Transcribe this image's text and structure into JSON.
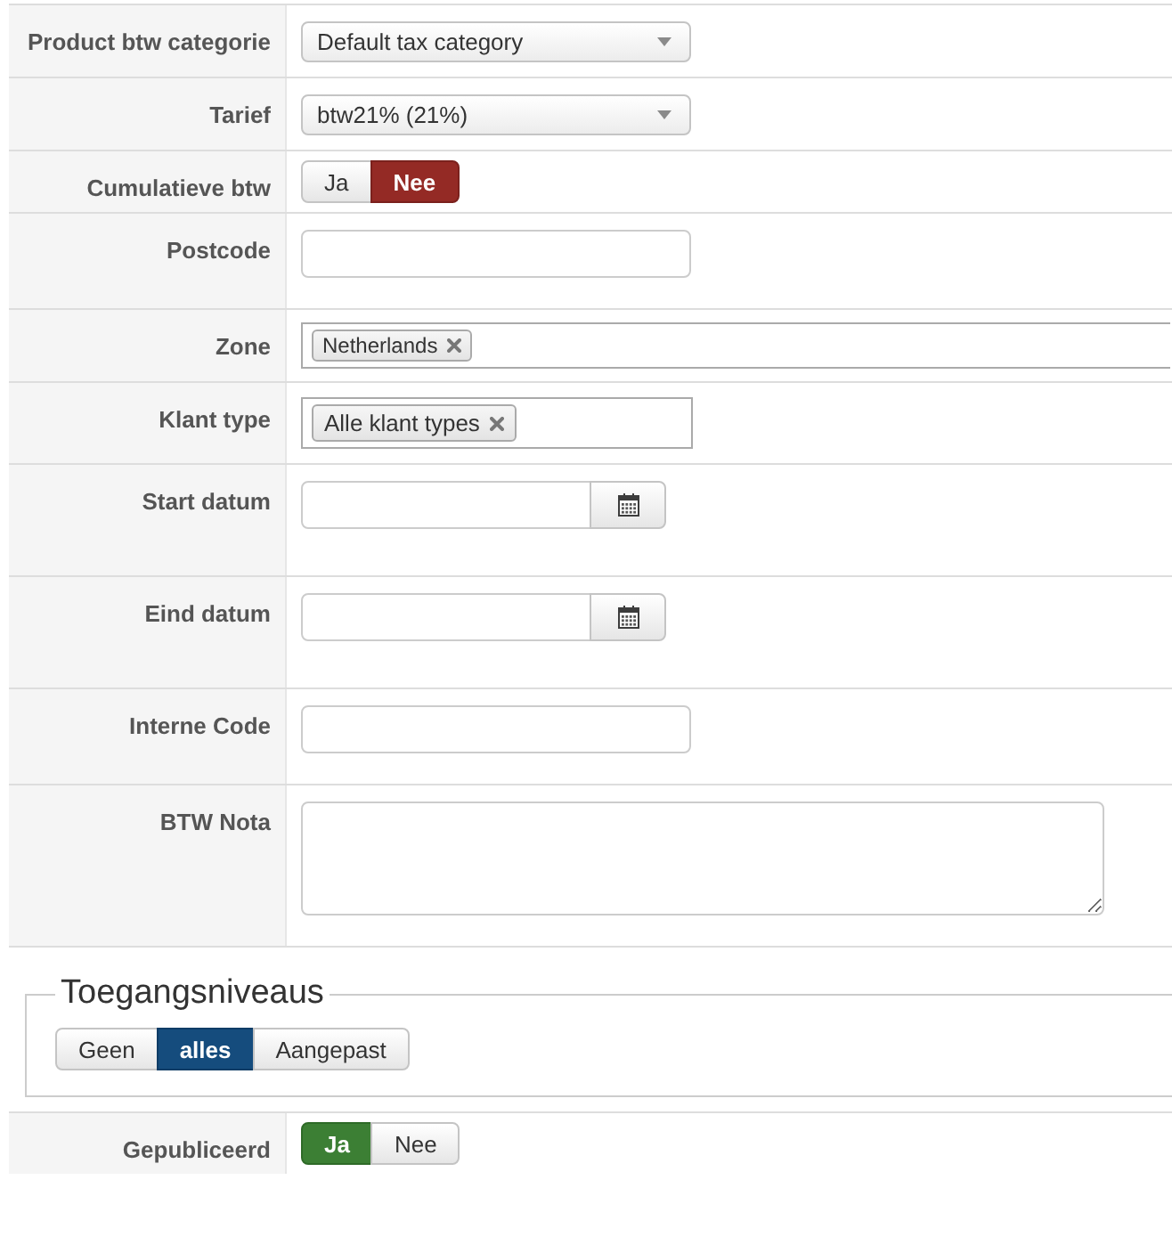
{
  "form_rows": [
    {
      "label": "Product btw categorie",
      "kind": "select",
      "value": "Default tax category"
    },
    {
      "label": "Tarief",
      "kind": "select",
      "value": "btw21% (21%)"
    },
    {
      "label": "Cumulatieve btw",
      "kind": "toggle",
      "options": [
        {
          "label": "Ja",
          "kind": "yes",
          "selected": false
        },
        {
          "label": "Nee",
          "kind": "no",
          "selected": true
        }
      ]
    },
    {
      "label": "Postcode",
      "kind": "text"
    },
    {
      "label": "Zone",
      "kind": "multiselect",
      "tags": [
        "Netherlands"
      ]
    },
    {
      "label": "Klant type",
      "kind": "tags",
      "tags": [
        "Alle klant types"
      ]
    },
    {
      "label": "Start datum",
      "kind": "date"
    },
    {
      "label": "Eind datum",
      "kind": "date"
    },
    {
      "label": "Interne Code",
      "kind": "text"
    },
    {
      "label": "BTW Nota",
      "kind": "textarea"
    }
  ],
  "access_levels": {
    "legend": "Toegangsniveaus",
    "options": [
      {
        "label": "Geen",
        "selected": false
      },
      {
        "label": "alles",
        "selected": true
      },
      {
        "label": "Aangepast",
        "selected": false
      }
    ]
  },
  "published": {
    "label": "Gepubliceerd",
    "kind": "toggle",
    "options": [
      {
        "label": "Ja",
        "kind": "yes",
        "selected": true
      },
      {
        "label": "Nee",
        "kind": "no",
        "selected": false
      }
    ]
  }
}
